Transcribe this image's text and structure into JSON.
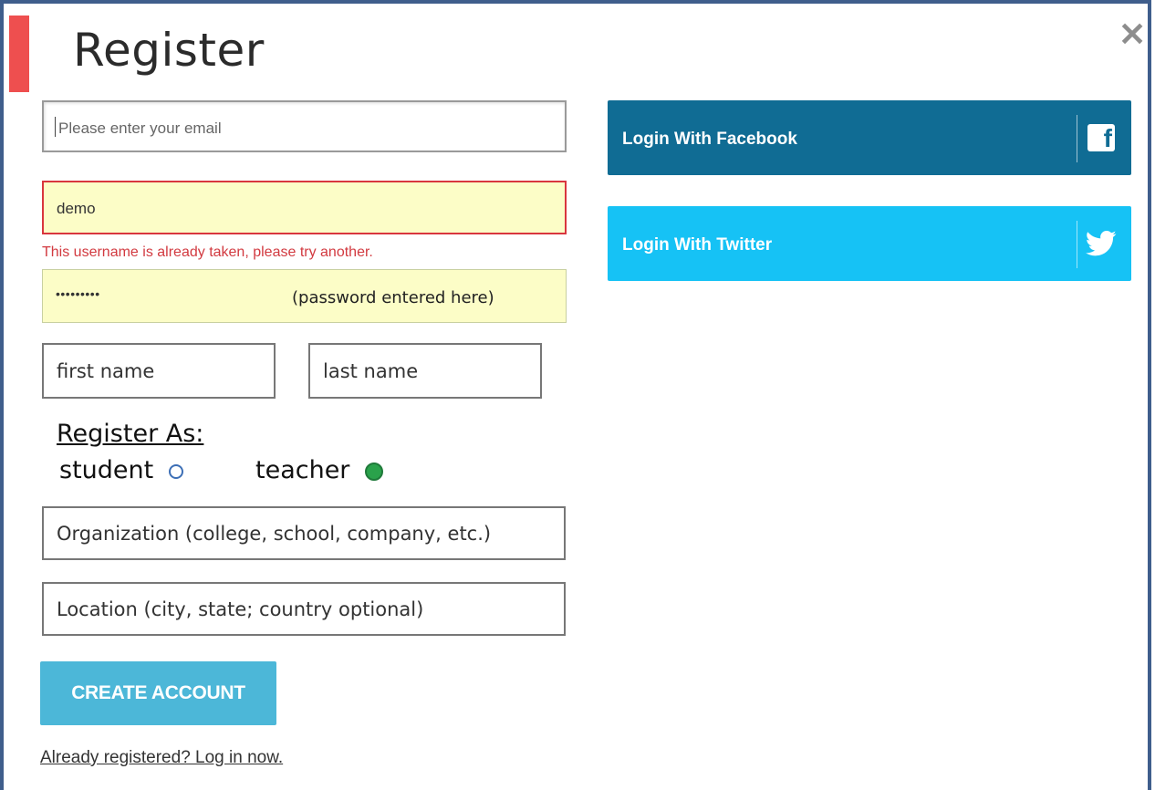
{
  "dialog": {
    "title": "Register",
    "close_glyph": "✕"
  },
  "form": {
    "email": {
      "placeholder": "Please enter your email"
    },
    "username": {
      "value": "demo",
      "error": "This username is already taken, please try another."
    },
    "password": {
      "value": "•••••••••",
      "note": "(password entered here)"
    },
    "first_name": "first name",
    "last_name": "last name",
    "register_as": {
      "label": "Register As:",
      "options": [
        {
          "label": "student",
          "selected": false
        },
        {
          "label": "teacher",
          "selected": true
        }
      ]
    },
    "organization": "Organization (college, school, company, etc.)",
    "location": "Location (city, state; country optional)",
    "submit_label": "CREATE ACCOUNT",
    "login_link": "Already registered? Log in now."
  },
  "social": {
    "facebook": {
      "label": "Login With Facebook",
      "icon": "facebook-icon",
      "color": "#106c94"
    },
    "twitter": {
      "label": "Login With Twitter",
      "icon": "twitter-icon",
      "color": "#16c2f5"
    }
  },
  "colors": {
    "accent": "#ee4f4f",
    "error": "#d23a40",
    "primary_button": "#4cb7d8",
    "selected_radio": "#2aa24b"
  }
}
